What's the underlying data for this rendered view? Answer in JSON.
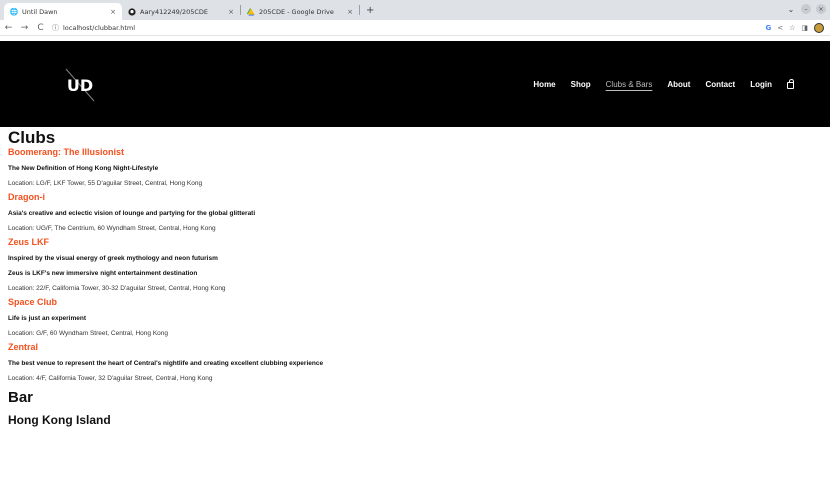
{
  "browser": {
    "tabs": [
      {
        "title": "Until Dawn",
        "icon": "globe-icon"
      },
      {
        "title": "Aary412249/205CDE",
        "icon": "github-icon"
      },
      {
        "title": "205CDE - Google Drive",
        "icon": "drive-icon"
      }
    ],
    "close_glyph": "×",
    "new_tab_glyph": "+",
    "url": "localhost/clubbar.html"
  },
  "site": {
    "logo_text": "UD",
    "nav": [
      "Home",
      "Shop",
      "Clubs & Bars",
      "About",
      "Contact",
      "Login"
    ]
  },
  "content": {
    "clubs_heading": "Clubs",
    "clubs": [
      {
        "name": "Boomerang: The Illusionist",
        "descriptions": [
          "The New Definition of Hong Kong Night-Lifestyle"
        ],
        "location": "Location: LG/F, LKF Tower, 55 D'aguilar Street, Central, Hong Kong"
      },
      {
        "name": "Dragon-i",
        "descriptions": [
          "Asia's creative and eclectic vision of lounge and partying for the global glitterati"
        ],
        "location": "Location: UG/F, The Centrium, 60 Wyndham Street, Central, Hong Kong"
      },
      {
        "name": "Zeus LKF",
        "descriptions": [
          "Inspired by the visual energy of greek mythology and neon futurism",
          "Zeus is LKF's new immersive night entertainment destination"
        ],
        "location": "Location: 22/F, California Tower, 30-32 D'aguilar Street, Central, Hong Kong"
      },
      {
        "name": "Space Club",
        "descriptions": [
          "Life is just an experiment"
        ],
        "location": "Location: G/F, 60 Wyndham Street, Central, Hong Kong"
      },
      {
        "name": "Zentral",
        "descriptions": [
          "The best venue to represent the heart of Central's nightlife and creating excellent clubbing experience"
        ],
        "location": "Location: 4/F, California Tower, 32 D'aguilar Street, Central, Hong Kong"
      }
    ],
    "bar_heading": "Bar",
    "region_heading": "Hong Kong Island"
  }
}
